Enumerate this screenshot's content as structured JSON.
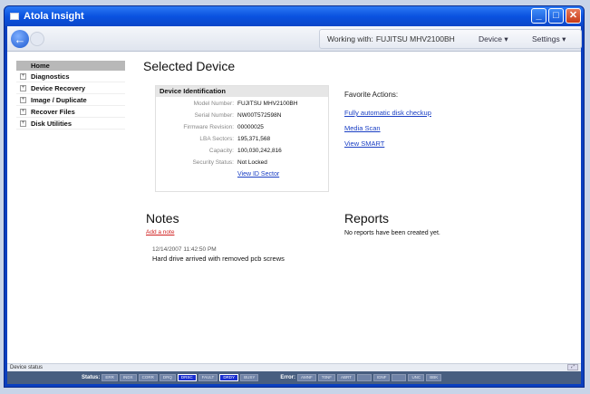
{
  "window": {
    "title": "Atola Insight"
  },
  "toolbar": {
    "working_label": "Working with:",
    "working_device": "FUJITSU MHV2100BH",
    "device_menu": "Device ▾",
    "settings_menu": "Settings ▾"
  },
  "sidebar": {
    "home": "Home",
    "items": [
      {
        "label": "Diagnostics"
      },
      {
        "label": "Device Recovery"
      },
      {
        "label": "Image / Duplicate"
      },
      {
        "label": "Recover Files"
      },
      {
        "label": "Disk Utilities"
      }
    ]
  },
  "main": {
    "title": "Selected Device",
    "device_box": {
      "heading": "Device Identification",
      "rows": [
        {
          "key": "Model Number:",
          "value": "FUJITSU MHV2100BH"
        },
        {
          "key": "Serial Number:",
          "value": "NW00T572598N"
        },
        {
          "key": "Firmware Revision:",
          "value": "00000025"
        },
        {
          "key": "LBA Sectors:",
          "value": "195,371,568"
        },
        {
          "key": "Capacity:",
          "value": "100,030,242,816"
        },
        {
          "key": "Security Status:",
          "value": "Not Locked"
        }
      ],
      "view_id_sector": "View ID Sector"
    },
    "favorites": {
      "title": "Favorite Actions:",
      "links": [
        "Fully automatic disk checkup",
        "Media Scan",
        "View SMART"
      ]
    },
    "notes": {
      "title": "Notes",
      "add_note": "Add a note",
      "entries": [
        {
          "time": "12/14/2007 11:42:50 PM",
          "text": "Hard drive arrived with removed pcb screws"
        }
      ]
    },
    "reports": {
      "title": "Reports",
      "empty_text": "No reports have been created yet."
    }
  },
  "statusline": {
    "text": "Device status",
    "corner": "⤢"
  },
  "statusbar": {
    "status_label": "Status:",
    "status_flags": [
      {
        "label": "ERR",
        "on": false
      },
      {
        "label": "INDX",
        "on": false
      },
      {
        "label": "CORR",
        "on": false
      },
      {
        "label": "DRQ",
        "on": false
      },
      {
        "label": "DRSC",
        "on": true
      },
      {
        "label": "FAULT",
        "on": false
      },
      {
        "label": "DRDY",
        "on": true
      },
      {
        "label": "BUSY",
        "on": false
      }
    ],
    "error_label": "Error:",
    "error_flags": [
      {
        "label": "AMNF",
        "on": false
      },
      {
        "label": "T0NF",
        "on": false
      },
      {
        "label": "ABRT",
        "on": false
      },
      {
        "label": "",
        "on": false
      },
      {
        "label": "IDNF",
        "on": false
      },
      {
        "label": "",
        "on": false
      },
      {
        "label": "UNC",
        "on": false
      },
      {
        "label": "BBK",
        "on": false
      }
    ]
  }
}
